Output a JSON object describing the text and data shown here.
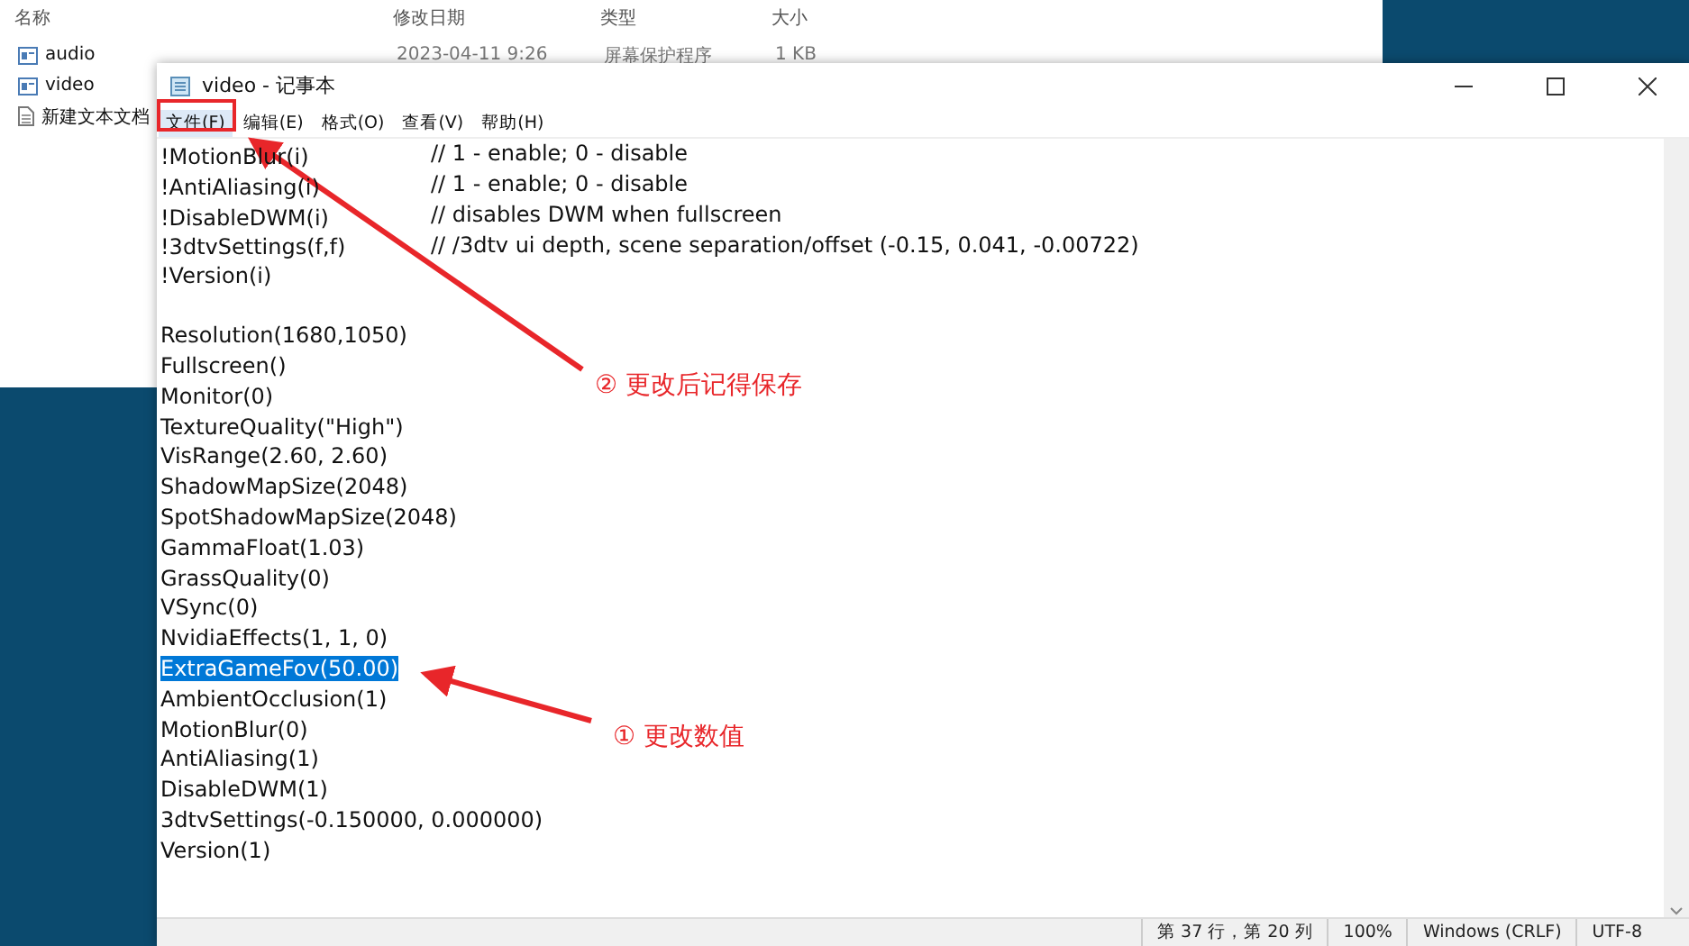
{
  "explorer": {
    "columns": [
      "名称",
      "修改日期",
      "类型",
      "大小"
    ],
    "files": [
      {
        "name": "audio",
        "kind": "config",
        "date": "2023-04-11 9:26",
        "type": "屏幕保护程序",
        "size": "1 KB"
      },
      {
        "name": "video",
        "kind": "config"
      },
      {
        "name": "新建文本文档",
        "kind": "text"
      }
    ]
  },
  "notepad": {
    "title": "video - 记事本",
    "menu": [
      {
        "label": "文件(F)",
        "highlighted": true
      },
      {
        "label": "编辑(E)",
        "highlighted": false
      },
      {
        "label": "格式(O)",
        "highlighted": false
      },
      {
        "label": "查看(V)",
        "highlighted": false
      },
      {
        "label": "帮助(H)",
        "highlighted": false
      }
    ],
    "lines": [
      {
        "text": "!MotionBlur(i)",
        "comment": "// 1 - enable; 0 - disable",
        "selected": false
      },
      {
        "text": "!AntiAliasing(i)",
        "comment": "// 1 - enable; 0 - disable",
        "selected": false
      },
      {
        "text": "!DisableDWM(i)",
        "comment": "// disables DWM when fullscreen",
        "selected": false
      },
      {
        "text": "!3dtvSettings(f,f)",
        "comment": "// /3dtv ui depth, scene separation/offset (-0.15, 0.041, -0.00722)",
        "selected": false
      },
      {
        "text": "!Version(i)",
        "selected": false
      },
      {
        "selected": false
      },
      {
        "text": "Resolution(1680,1050)",
        "selected": false
      },
      {
        "text": "Fullscreen()",
        "selected": false
      },
      {
        "text": "Monitor(0)",
        "selected": false
      },
      {
        "text": "TextureQuality(\"High\")",
        "selected": false
      },
      {
        "text": "VisRange(2.60, 2.60)",
        "selected": false
      },
      {
        "text": "ShadowMapSize(2048)",
        "selected": false
      },
      {
        "text": "SpotShadowMapSize(2048)",
        "selected": false
      },
      {
        "text": "GammaFloat(1.03)",
        "selected": false
      },
      {
        "text": "GrassQuality(0)",
        "selected": false
      },
      {
        "text": "VSync(0)",
        "selected": false
      },
      {
        "text": "NvidiaEffects(1, 1, 0)",
        "selected": false
      },
      {
        "text": "ExtraGameFov(50.00)",
        "selected": true
      },
      {
        "text": "AmbientOcclusion(1)",
        "selected": false
      },
      {
        "text": "MotionBlur(0)",
        "selected": false
      },
      {
        "text": "AntiAliasing(1)",
        "selected": false
      },
      {
        "text": "DisableDWM(1)",
        "selected": false
      },
      {
        "text": "3dtvSettings(-0.150000, 0.000000)",
        "selected": false
      },
      {
        "text": "Version(1)",
        "selected": false
      }
    ],
    "status_bar": [
      "第 37 行，第 20 列",
      "100%",
      "Windows (CRLF)",
      "UTF-8"
    ]
  },
  "annotations": [
    {
      "text": "② 更改后记得保存"
    },
    {
      "text": "① 更改数值"
    }
  ]
}
